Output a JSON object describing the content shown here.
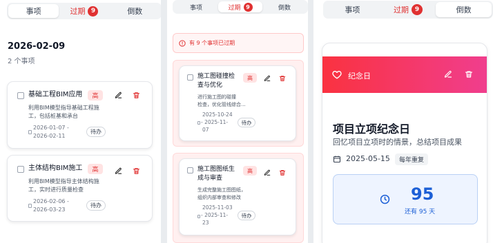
{
  "tabs": {
    "items": "事项",
    "overdue": "过期",
    "overdue_count": "9",
    "countdown": "倒数"
  },
  "panel1": {
    "date_heading": "2026-02-09",
    "item_count": "2 个事项",
    "tasks": [
      {
        "title": "基础工程BIM应用",
        "priority": "高",
        "description": "利用BIM模型指导基础工程施工，包括桩基和承台",
        "start": "2026-01-07 -",
        "end": "2026-02-11",
        "status": "待办"
      },
      {
        "title": "主体结构BIM施工",
        "priority": "高",
        "description": "利用BIM模型指导主体结构施工，实时进行质量检查",
        "start": "2026-02-06 -",
        "end": "2026-03-23",
        "status": "待办"
      }
    ]
  },
  "panel2": {
    "alert": "有 9 个事项已过期",
    "tasks": [
      {
        "title_l1": "施工图碰撞检",
        "title_l2": "查与优化",
        "priority": "高",
        "desc_l1": "进行施工图的碰撞",
        "desc_l2": "检查，优化管线综合...",
        "date_l1": "2025-10-24",
        "date_l2": "- 2025-11-",
        "date_l3": "07",
        "status": "待办"
      },
      {
        "title_l1": "施工图图纸生",
        "title_l2": "成与审查",
        "priority": "高",
        "desc_l1": "生成完整施工图图纸，",
        "desc_l2": "组织内部审查和修改",
        "date_l1": "2025-11-03",
        "date_l2": "- 2025-11-",
        "date_l3": "23",
        "status": "待办"
      }
    ]
  },
  "panel3": {
    "card_label": "纪念日",
    "title": "项目立项纪念日",
    "subtitle": "回忆项目立项时的情景，总结项目成果",
    "date": "2025-05-15",
    "repeat": "每年重复",
    "days": "95",
    "days_caption": "还有 95 天"
  },
  "colors": {
    "accent_red": "#e03131",
    "banner_start": "#fa3240",
    "banner_end": "#f03e8e",
    "count_blue": "#1c5fd6"
  }
}
